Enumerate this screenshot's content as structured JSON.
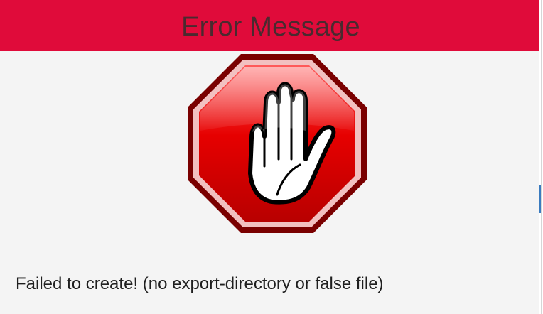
{
  "dialog": {
    "title": "Error Message",
    "message": "Failed to create! (no export-directory or false file)",
    "icon": "stop-hand-icon"
  },
  "colors": {
    "title_bar": "#e00b3a",
    "title_text": "#4a2a2f",
    "stop_red": "#d40000",
    "stop_border": "#7a0000",
    "background": "#f4f4f4"
  }
}
